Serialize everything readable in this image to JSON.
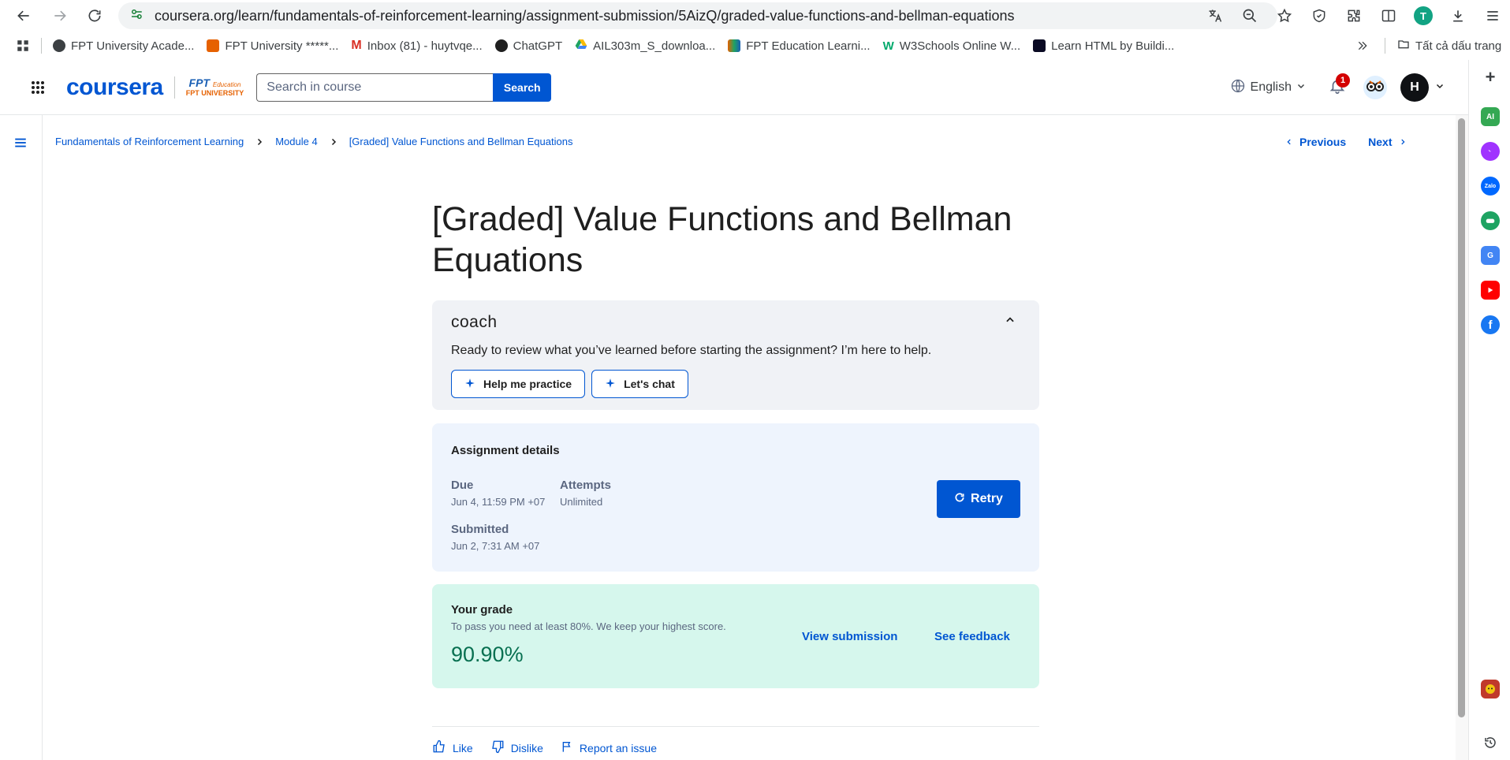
{
  "browser": {
    "url": "coursera.org/learn/fundamentals-of-reinforcement-learning/assignment-submission/5AizQ/graded-value-functions-and-bellman-equations",
    "profile_initial": "T",
    "bookmarks": [
      {
        "label": "FPT University Acade...",
        "color": "#3c4043"
      },
      {
        "label": "FPT University *****...",
        "color": "#e66100"
      },
      {
        "label": "Inbox (81) - huytvqe...",
        "color": "#d93025"
      },
      {
        "label": "ChatGPT",
        "color": "#1f1f1f"
      },
      {
        "label": "AIL303m_S_downloa...",
        "color": "#1ea362"
      },
      {
        "label": "FPT Education Learni...",
        "color": "#e66100"
      },
      {
        "label": "W3Schools Online W...",
        "color": "#04aa6d"
      },
      {
        "label": "Learn HTML by Buildi...",
        "color": "#0a0a23"
      }
    ],
    "all_bookmarks_label": "Tất cả dấu trang"
  },
  "header": {
    "logo": "coursera",
    "partner_top": "FPT",
    "partner_small": "Education",
    "partner_bottom": "FPT UNIVERSITY",
    "search_placeholder": "Search in course",
    "search_button": "Search",
    "language": "English",
    "notification_count": "1",
    "user_initial": "H"
  },
  "breadcrumb": {
    "items": [
      "Fundamentals of Reinforcement Learning",
      "Module 4",
      "[Graded] Value Functions and Bellman Equations"
    ],
    "previous": "Previous",
    "next": "Next"
  },
  "page": {
    "title": "[Graded] Value Functions and Bellman Equations"
  },
  "coach": {
    "logo": "coach",
    "message": "Ready to review what you’ve learned before starting the assignment? I’m here to help.",
    "help_button": "Help me practice",
    "chat_button": "Let's chat"
  },
  "assignment": {
    "title": "Assignment details",
    "due_label": "Due",
    "due_value": "Jun 4, 11:59 PM +07",
    "attempts_label": "Attempts",
    "attempts_value": "Unlimited",
    "submitted_label": "Submitted",
    "submitted_value": "Jun 2, 7:31 AM +07",
    "retry_button": "Retry"
  },
  "grade": {
    "title": "Your grade",
    "subtitle": "To pass you need at least 80%. We keep your highest score.",
    "value": "90.90%",
    "view_submission": "View submission",
    "see_feedback": "See feedback"
  },
  "feedback": {
    "like": "Like",
    "dislike": "Dislike",
    "report": "Report an issue"
  },
  "colors": {
    "brand": "#0056d2",
    "grade_green": "#087051",
    "grade_bg": "#d6f7ed",
    "assign_bg": "#eef4fd",
    "coach_bg": "#f0f2f6"
  }
}
